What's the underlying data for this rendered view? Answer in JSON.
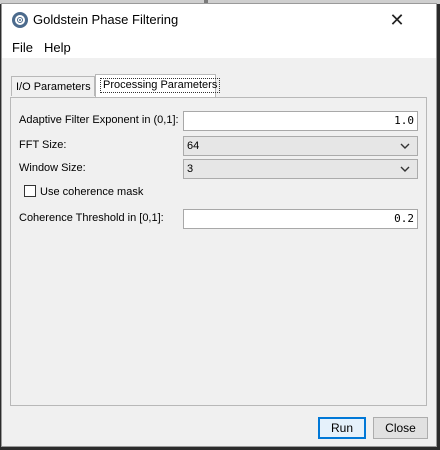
{
  "window": {
    "title": "Goldstein Phase Filtering"
  },
  "menu": [
    "File",
    "Help"
  ],
  "tabs": [
    {
      "label": "I/O Parameters",
      "active": false
    },
    {
      "label": "Processing Parameters",
      "active": true
    }
  ],
  "params": {
    "adaptive_label": "Adaptive Filter Exponent in (0,1]:",
    "adaptive_value": "1.0",
    "fft_label": "FFT Size:",
    "fft_value": "64",
    "window_label": "Window Size:",
    "window_value": "3",
    "coherence_mask_label": "Use coherence mask",
    "coherence_mask_checked": false,
    "coherence_threshold_label": "Coherence Threshold in [0,1]:",
    "coherence_threshold_value": "0.2"
  },
  "buttons": {
    "run": "Run",
    "close": "Close"
  },
  "icons": {
    "app": "snap-app-icon",
    "close": "close-icon",
    "dropdown": "chevron-down-icon"
  },
  "colors": {
    "default_button_border": "#0078d7"
  }
}
